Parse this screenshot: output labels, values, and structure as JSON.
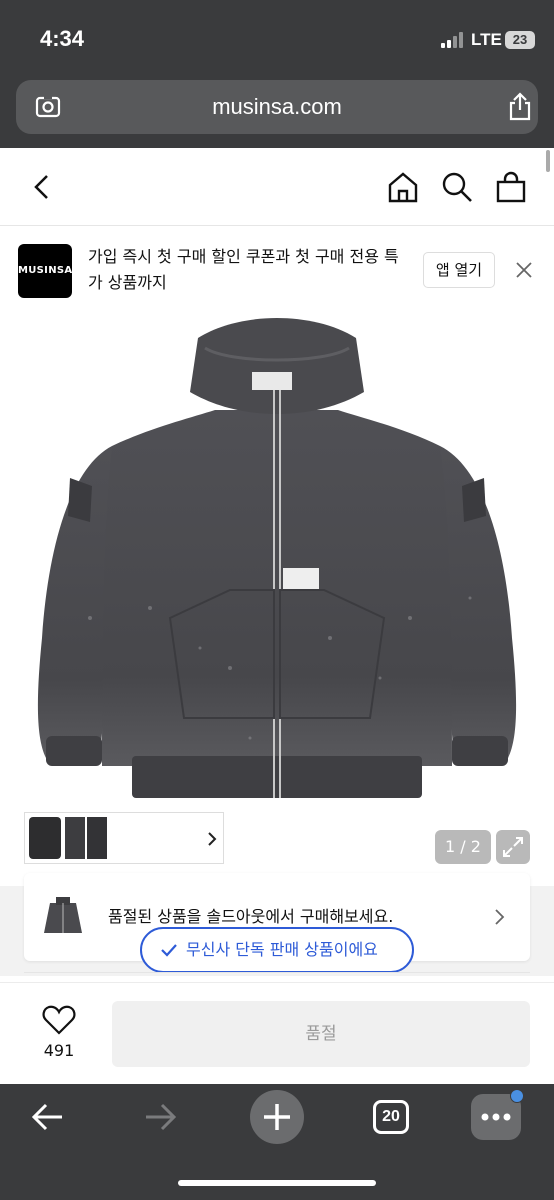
{
  "status_bar": {
    "time": "4:34",
    "network": "LTE",
    "battery": "23"
  },
  "browser": {
    "url": "musinsa.com"
  },
  "banner": {
    "logo_text": "MUSINSA",
    "message": "가입 즉시 첫 구매 할인 쿠폰과 첫 구매 전용 특가 상품까지",
    "open_app_label": "앱 열기"
  },
  "gallery": {
    "page_indicator": "1 / 2"
  },
  "soldout": {
    "message": "품절된 상품을 솔드아웃에서 구매해보세요."
  },
  "badge": {
    "label": "무신사 단독 판매 상품이에요"
  },
  "actions": {
    "like_count": "491",
    "buy_label": "품절"
  },
  "toolbar": {
    "tab_count": "20"
  },
  "colors": {
    "accent": "#2e5bd7",
    "safari_bg": "#3a3b3d",
    "jacket": "#4c4c50"
  }
}
